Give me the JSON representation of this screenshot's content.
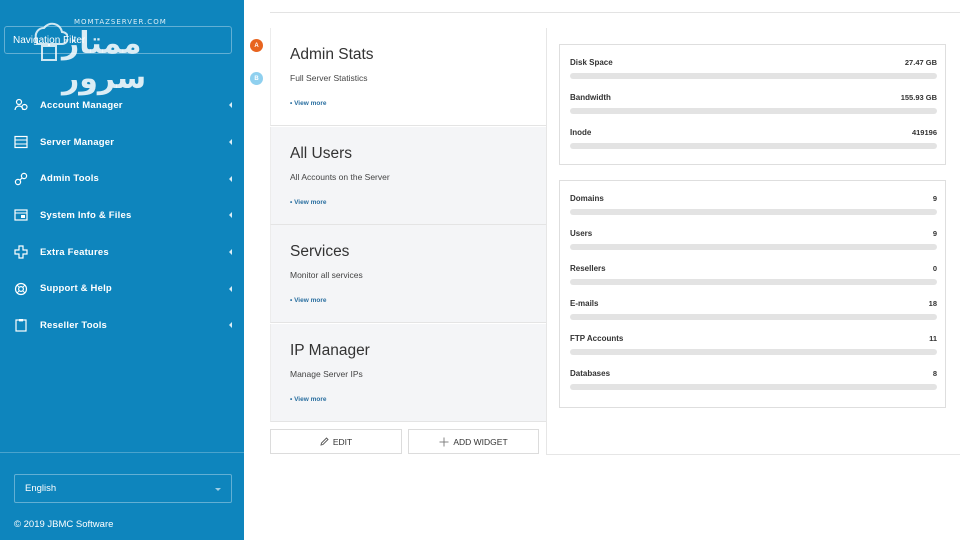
{
  "sidebar": {
    "nav_filter_placeholder": "Navigation Filter",
    "logo_top": "MOMTAZSERVER.COM",
    "logo_main": "ممتاز سرور",
    "items": [
      {
        "label": "Account Manager",
        "icon": "users-icon"
      },
      {
        "label": "Server Manager",
        "icon": "server-icon"
      },
      {
        "label": "Admin Tools",
        "icon": "tools-icon"
      },
      {
        "label": "System Info & Files",
        "icon": "folder-icon"
      },
      {
        "label": "Extra Features",
        "icon": "puzzle-icon"
      },
      {
        "label": "Support & Help",
        "icon": "lifebuoy-icon"
      },
      {
        "label": "Reseller Tools",
        "icon": "clipboard-icon"
      }
    ],
    "language": "English",
    "copyright": "© 2019 JBMC Software"
  },
  "badges": {
    "a": "A",
    "b": "B"
  },
  "widgets": [
    {
      "title": "Admin Stats",
      "subtitle": "Full Server Statistics",
      "more": "• View more"
    },
    {
      "title": "All Users",
      "subtitle": "All Accounts on the Server",
      "more": "• View more"
    },
    {
      "title": "Services",
      "subtitle": "Monitor all services",
      "more": "• View more"
    },
    {
      "title": "IP Manager",
      "subtitle": "Manage Server IPs",
      "more": "• View more"
    }
  ],
  "buttons": {
    "edit": "EDIT",
    "add_widget": "ADD WIDGET"
  },
  "stats_top": [
    {
      "label": "Disk Space",
      "value": "27.47 GB",
      "usage": 0
    },
    {
      "label": "Bandwidth",
      "value": "155.93 GB",
      "usage": 0
    },
    {
      "label": "Inode",
      "value": "419196",
      "usage": 0
    }
  ],
  "stats_bottom": [
    {
      "label": "Domains",
      "value": "9",
      "usage": 0
    },
    {
      "label": "Users",
      "value": "9",
      "usage": 0
    },
    {
      "label": "Resellers",
      "value": "0",
      "usage": 0
    },
    {
      "label": "E-mails",
      "value": "18",
      "usage": 0
    },
    {
      "label": "FTP Accounts",
      "value": "11",
      "usage": 0
    },
    {
      "label": "Databases",
      "value": "8",
      "usage": 0
    }
  ],
  "colors": {
    "sidebar_bg": "#0e85bd",
    "badge_a": "#e8641f",
    "badge_b": "#8fd0ef",
    "link": "#2a6fa0"
  }
}
